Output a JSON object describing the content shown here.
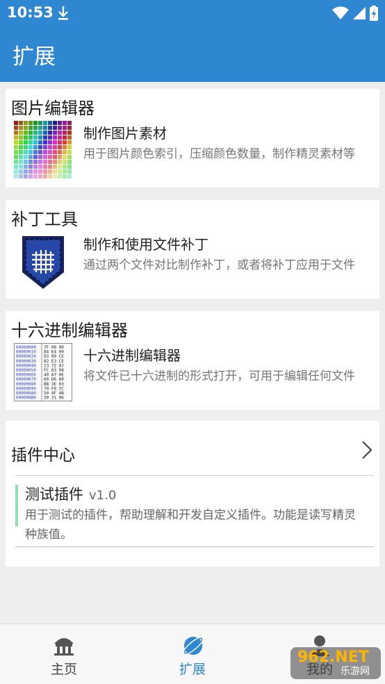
{
  "statusbar": {
    "time": "10:53"
  },
  "appbar": {
    "title": "扩展"
  },
  "cards": [
    {
      "title": "图片编辑器",
      "subtitle": "制作图片素材",
      "description": "用于图片颜色索引，压缩颜色数量，制作精灵素材等",
      "icon": "palette-icon"
    },
    {
      "title": "补丁工具",
      "subtitle": "制作和使用文件补丁",
      "description": "通过两个文件对比制作补丁，或者将补丁应用于文件",
      "icon": "patch-icon"
    },
    {
      "title": "十六进制编辑器",
      "subtitle": "十六进制编辑器",
      "description": "将文件已十六进制的形式打开，可用于编辑任何文件",
      "icon": "hex-icon"
    }
  ],
  "hex_preview": {
    "addresses": [
      "00000000",
      "00000010",
      "00000020",
      "00000030",
      "00000040",
      "00000050",
      "00000060",
      "00000070",
      "00000080",
      "00000090",
      "000000A0",
      "000000B0"
    ],
    "bytes": [
      "7F 00 00",
      "84 E4 09",
      "93 09 CE",
      "82 E3 CE",
      "13 72 A7",
      "FC 03 98",
      "40 A7 0E",
      "60 D6 80",
      "BB 3E 03",
      "70 F0 2C",
      "50 4F 4B",
      "30 31 96"
    ]
  },
  "plugins": {
    "title": "插件中心",
    "items": [
      {
        "name": "测试插件",
        "version": "v1.0",
        "description": "用于测试的插件，帮助理解和开发自定义插件。功能是读写精灵种族值。"
      }
    ]
  },
  "nav": {
    "home": "主页",
    "extensions": "扩展",
    "me": "我的"
  },
  "watermark": {
    "brand": "962.NET",
    "sub": "乐游网"
  },
  "colors": {
    "primary": "#2f86d1",
    "plugin_accent": "#8fe0b0"
  }
}
